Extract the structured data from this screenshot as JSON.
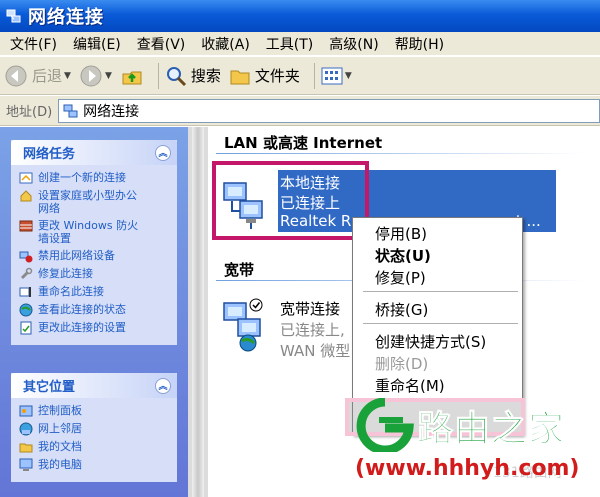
{
  "window": {
    "title": "网络连接"
  },
  "menu": [
    "文件(F)",
    "编辑(E)",
    "查看(V)",
    "收藏(A)",
    "工具(T)",
    "高级(N)",
    "帮助(H)"
  ],
  "toolbar": {
    "back": "后退",
    "search": "搜索",
    "folders": "文件夹"
  },
  "address": {
    "label": "地址(D)",
    "value": "网络连接"
  },
  "tasks_panel": {
    "title": "网络任务",
    "items": [
      "创建一个新的连接",
      "设置家庭或小型办公",
      "网络",
      "更改 Windows 防火",
      "墙设置",
      "禁用此网络设备",
      "修复此连接",
      "重命名此连接",
      "查看此连接的状态",
      "更改此连接的设置"
    ]
  },
  "places_panel": {
    "title": "其它位置",
    "items": [
      "控制面板",
      "网上邻居",
      "我的文档",
      "我的电脑"
    ]
  },
  "groups": {
    "lan": "LAN 或高速 Internet",
    "broadband": "宽带"
  },
  "lan_connection": {
    "name": "本地连接",
    "status": "已连接上",
    "device": "Realtek R",
    "device_tail": "st ..."
  },
  "broadband_connection": {
    "name": "宽带连接",
    "status": "已连接上,",
    "device": "WAN 微型"
  },
  "context_menu": [
    "停用(B)",
    "状态(U)",
    "修复(P)",
    "桥接(G)",
    "创建快捷方式(S)",
    "删除(D)",
    "重命名(M)"
  ],
  "watermark": {
    "brand": "路由之家",
    "url": "(www.hhhyh.com)",
    "faint": "131路由网"
  },
  "colors": {
    "title_blue": "#0a5ad8",
    "selection_blue": "#316ac5",
    "highlight_magenta": "#c4176a",
    "brand_green": "#1aa23a",
    "url_red": "#d21b1b"
  }
}
